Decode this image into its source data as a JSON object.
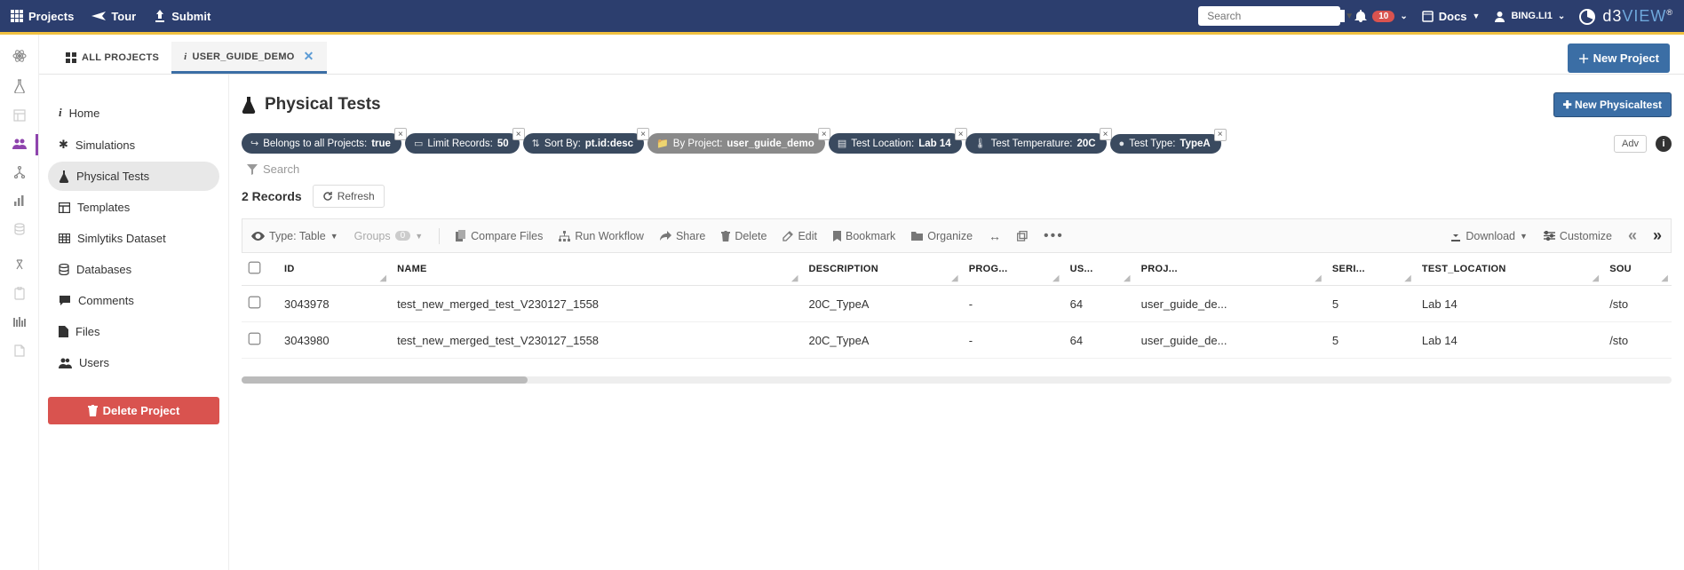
{
  "navbar": {
    "projects": "Projects",
    "tour": "Tour",
    "submit": "Submit",
    "search_placeholder": "Search",
    "notif_count": "10",
    "docs": "Docs",
    "user": "BING.LI1",
    "brand_d3": "d3",
    "brand_view": "VIEW"
  },
  "tabs": {
    "all": "ALL PROJECTS",
    "current": "USER_GUIDE_DEMO",
    "new_project": "New Project"
  },
  "sidebar": {
    "items": [
      {
        "label": "Home"
      },
      {
        "label": "Simulations"
      },
      {
        "label": "Physical Tests"
      },
      {
        "label": "Templates"
      },
      {
        "label": "Simlytiks Dataset"
      },
      {
        "label": "Databases"
      },
      {
        "label": "Comments"
      },
      {
        "label": "Files"
      },
      {
        "label": "Users"
      }
    ],
    "delete": "Delete Project"
  },
  "page": {
    "title": "Physical Tests",
    "new_btn": "New Physicaltest"
  },
  "filters": [
    {
      "label": "Belongs to all Projects:",
      "value": "true",
      "closable": true,
      "light": false
    },
    {
      "label": "Limit Records:",
      "value": "50",
      "closable": true,
      "light": false
    },
    {
      "label": "Sort By:",
      "value": "pt.id:desc",
      "closable": true,
      "light": false
    },
    {
      "label": "By Project:",
      "value": "user_guide_demo",
      "closable": true,
      "light": true
    },
    {
      "label": "Test Location:",
      "value": "Lab 14",
      "closable": true,
      "light": false
    },
    {
      "label": "Test Temperature:",
      "value": "20C",
      "closable": true,
      "light": false
    },
    {
      "label": "Test Type:",
      "value": "TypeA",
      "closable": true,
      "light": false
    }
  ],
  "filter_bar": {
    "adv": "Adv",
    "search_hint": "Search"
  },
  "records": {
    "count_text": "2 Records",
    "refresh": "Refresh"
  },
  "toolbar": {
    "type_label": "Type: Table",
    "groups_label": "Groups",
    "groups_count": "0",
    "compare": "Compare Files",
    "workflow": "Run Workflow",
    "share": "Share",
    "delete": "Delete",
    "edit": "Edit",
    "bookmark": "Bookmark",
    "organize": "Organize",
    "download": "Download",
    "customize": "Customize"
  },
  "table": {
    "headers": [
      "",
      "ID",
      "NAME",
      "DESCRIPTION",
      "PROG...",
      "US...",
      "PROJ...",
      "SERI...",
      "TEST_LOCATION",
      "SOU"
    ],
    "rows": [
      {
        "id": "3043978",
        "name": "test_new_merged_test_V230127_1558",
        "desc": "20C_TypeA",
        "prog": "-",
        "us": "64",
        "proj": "user_guide_de...",
        "seri": "5",
        "loc": "Lab 14",
        "sou": "/sto"
      },
      {
        "id": "3043980",
        "name": "test_new_merged_test_V230127_1558",
        "desc": "20C_TypeA",
        "prog": "-",
        "us": "64",
        "proj": "user_guide_de...",
        "seri": "5",
        "loc": "Lab 14",
        "sou": "/sto"
      }
    ]
  }
}
